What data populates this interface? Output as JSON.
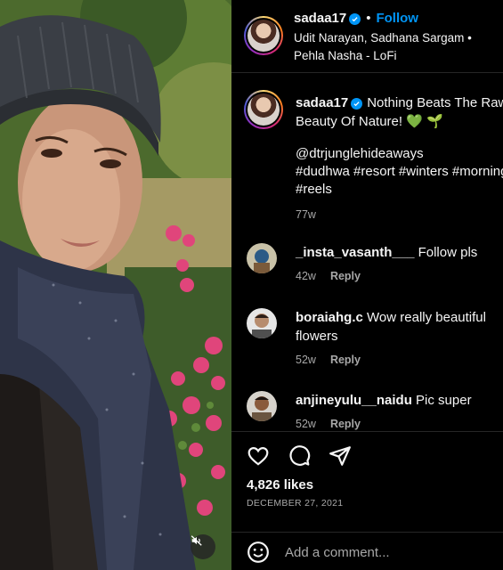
{
  "post": {
    "username": "sadaa17",
    "follow_label": "Follow",
    "separator": "•",
    "audio": "Udit Narayan, Sadhana Sargam • Pehla Nasha - LoFi",
    "caption": "Nothing Beats The Raw Beauty Of Nature! 💚 🌱",
    "mention": "@dtrjunglehideaways",
    "hashtags": "#dudhwa #resort #winters #morning #reels",
    "caption_age": "77w",
    "verified_icon": "verified-badge-icon"
  },
  "comments": [
    {
      "username": "_insta_vasanth___",
      "text": "Follow pls",
      "age": "42w",
      "reply_label": "Reply"
    },
    {
      "username": "boraiahg.c",
      "text": "Wow really beautiful flowers",
      "age": "52w",
      "reply_label": "Reply"
    },
    {
      "username": "anjineyulu__naidu",
      "text": "Pic super",
      "age": "52w",
      "reply_label": "Reply"
    }
  ],
  "actions": {
    "likes": "4,826 likes",
    "date": "DECEMBER 27, 2021",
    "icons": [
      "heart-icon",
      "comment-icon",
      "share-icon"
    ]
  },
  "composer": {
    "placeholder": "Add a comment...",
    "emoji_icon": "emoji-icon"
  },
  "media": {
    "mute_icon": "speaker-muted-icon"
  },
  "colors": {
    "background": "#000000",
    "accent_blue": "#0095f6",
    "muted_text": "#a8a8a8",
    "divider": "#262626",
    "heart_green": "#2ecc71"
  }
}
